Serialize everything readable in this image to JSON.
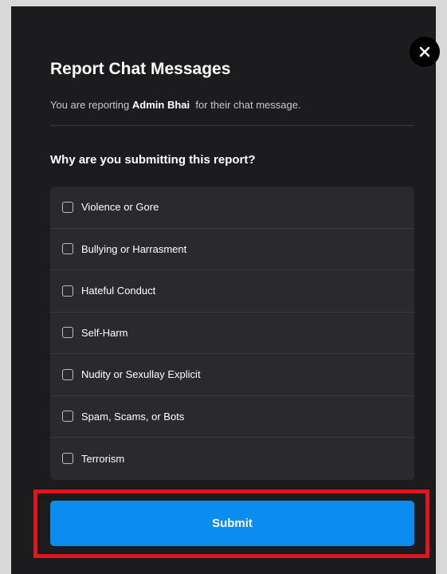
{
  "dialog": {
    "title": "Report Chat Messages",
    "subtitle_prefix": "You are reporting",
    "reported_user": "Admin Bhai",
    "subtitle_suffix": "for their chat message.",
    "question": "Why are you submitting this report?",
    "close_icon": "close-icon"
  },
  "options": [
    {
      "label": "Violence or Gore",
      "checked": false
    },
    {
      "label": "Bullying or Harrasment",
      "checked": false
    },
    {
      "label": "Hateful Conduct",
      "checked": false
    },
    {
      "label": "Self-Harm",
      "checked": false
    },
    {
      "label": "Nudity or Sexullay Explicit",
      "checked": false
    },
    {
      "label": "Spam, Scams, or Bots",
      "checked": false
    },
    {
      "label": "Terrorism",
      "checked": false
    }
  ],
  "submit": {
    "label": "Submit"
  },
  "colors": {
    "accent": "#0a8cf0",
    "highlight": "#e0161c",
    "panel": "#1c1c1e"
  }
}
